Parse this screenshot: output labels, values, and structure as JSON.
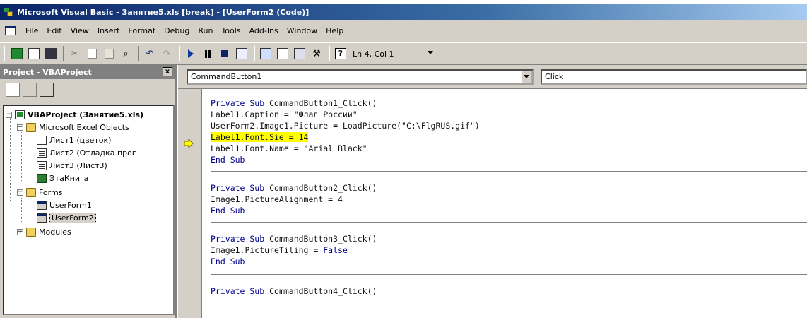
{
  "window": {
    "title": "Microsoft Visual Basic - Занятие5.xls [break] - [UserForm2 (Code)]"
  },
  "menu": [
    "File",
    "Edit",
    "View",
    "Insert",
    "Format",
    "Debug",
    "Run",
    "Tools",
    "Add-Ins",
    "Window",
    "Help"
  ],
  "toolbar": {
    "position": "Ln 4, Col 1"
  },
  "project": {
    "title": "Project - VBAProject",
    "close": "x",
    "tree": {
      "root": "VBAProject (Занятие5.xls)",
      "excel_objects": "Microsoft Excel Objects",
      "sheet1": "Лист1 (цветок)",
      "sheet2": "Лист2 (Отладка прог",
      "sheet3": "Лист3 (Лист3)",
      "workbook": "ЭтаКнига",
      "forms": "Forms",
      "form1": "UserForm1",
      "form2": "UserForm2",
      "modules": "Modules"
    }
  },
  "code": {
    "object": "CommandButton1",
    "procedure": "Click",
    "lines": {
      "l1a": "Private Sub",
      "l1b": " CommandButton1_Click()",
      "l2": "Label1.Caption = \"Флаг России\"",
      "l3": "UserForm2.Image1.Picture = LoadPicture(\"C:\\FlgRUS.gif\")",
      "l4": "Label1.Font.Sie = 14",
      "l5": "Label1.Font.Name = \"Arial Black\"",
      "l6": "End Sub",
      "l7a": "Private Sub",
      "l7b": " CommandButton2_Click()",
      "l8": "Image1.PictureAlignment = 4",
      "l9": "End Sub",
      "l10a": "Private Sub",
      "l10b": " CommandButton3_Click()",
      "l11a": "Image1.PictureTiling = ",
      "l11b": "False",
      "l12": "End Sub",
      "l13a": "Private Sub",
      "l13b": " CommandButton4_Click()"
    }
  },
  "colors": {
    "titlebar": "#0a246a",
    "keyword": "#00008b",
    "highlight": "#ffff00",
    "chrome": "#d4d0c8"
  }
}
